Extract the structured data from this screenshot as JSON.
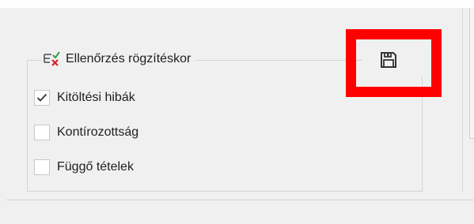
{
  "group": {
    "title": "Ellenőrzés rögzítéskor",
    "header_icon": "checklist-error-icon"
  },
  "options": [
    {
      "label": "Kitöltési hibák",
      "checked": true
    },
    {
      "label": "Kontírozottság",
      "checked": false
    },
    {
      "label": "Függő tételek",
      "checked": false
    }
  ],
  "save": {
    "icon": "save-icon",
    "highlight_color": "#ff0000"
  }
}
